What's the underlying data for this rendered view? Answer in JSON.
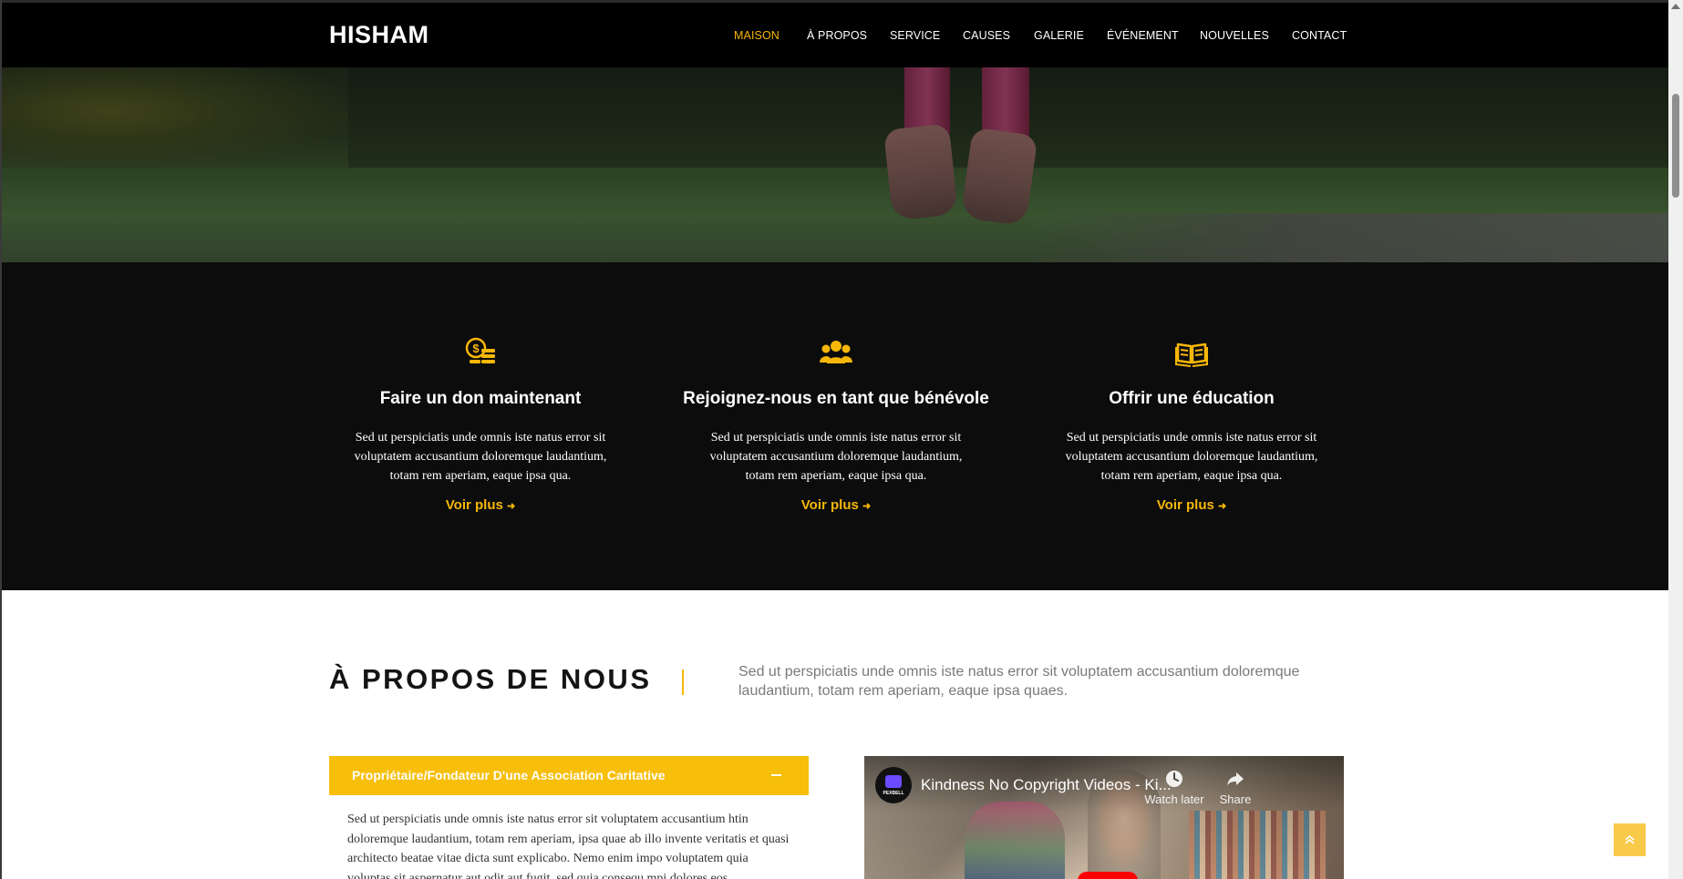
{
  "brand": {
    "logo": "HISHAM",
    "accent_color": "#f7b708"
  },
  "nav": {
    "items": [
      {
        "label": "MAISON",
        "active": true
      },
      {
        "label": "À PROPOS"
      },
      {
        "label": "SERVICE"
      },
      {
        "label": "CAUSES"
      },
      {
        "label": "GALERIE"
      },
      {
        "label": "ÉVÉNEMENT"
      },
      {
        "label": "NOUVELLES"
      },
      {
        "label": "CONTACT"
      }
    ]
  },
  "features": [
    {
      "icon": "coins-icon",
      "title": "Faire un don maintenant",
      "text": "Sed ut perspiciatis unde omnis iste natus error sit voluptatem accusantium doloremque laudantium, totam rem aperiam, eaque ipsa qua.",
      "link": "Voir plus"
    },
    {
      "icon": "users-icon",
      "title": "Rejoignez-nous en tant que bénévole",
      "text": "Sed ut perspiciatis unde omnis iste natus error sit voluptatem accusantium doloremque laudantium, totam rem aperiam, eaque ipsa qua.",
      "link": "Voir plus"
    },
    {
      "icon": "open-book-icon",
      "title": "Offrir une éducation",
      "text": "Sed ut perspiciatis unde omnis iste natus error sit voluptatem accusantium doloremque laudantium, totam rem aperiam, eaque ipsa qua.",
      "link": "Voir plus"
    }
  ],
  "about": {
    "heading": "À PROPOS DE NOUS",
    "lead": "Sed ut perspiciatis unde omnis iste natus error sit voluptatem accusantium doloremque laudantium, totam rem aperiam, eaque ipsa quaes.",
    "accordion": {
      "title": "Propriétaire/Fondateur D'une Association Caritative",
      "toggle_icon": "minus-icon",
      "body": "Sed ut perspiciatis unde omnis iste natus error sit voluptatem accusantium htin doloremque laudantium, totam rem aperiam, ipsa quae ab illo invente veritatis et quasi architecto beatae vitae dicta sunt explicabo. Nemo enim impo voluptatem quia voluptas sit aspernatur aut odit aut fugit, sed quia consequ mpi dolores eos"
    },
    "video": {
      "channel_tag": "PEXBELL",
      "title": "Kindness No Copyright Videos - Ki...",
      "watch_later": "Watch later",
      "share": "Share"
    }
  }
}
